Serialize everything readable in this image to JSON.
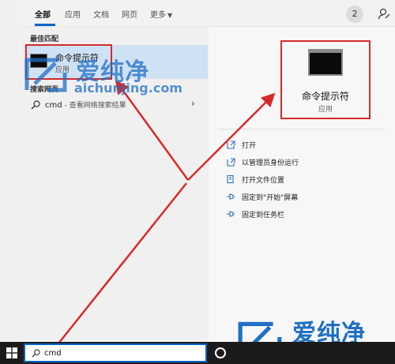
{
  "tabs": [
    {
      "label": "全部"
    },
    {
      "label": "应用"
    },
    {
      "label": "文档"
    },
    {
      "label": "网页"
    },
    {
      "label": "更多"
    }
  ],
  "header": {
    "badge_count": "2"
  },
  "best_match": {
    "section_label": "最佳匹配",
    "title": "命令提示符",
    "subtitle": "应用"
  },
  "web": {
    "section_label": "搜索网页",
    "query": "cmd",
    "suffix": " - 查看网络搜索结果"
  },
  "preview": {
    "title": "命令提示符",
    "subtitle": "应用",
    "actions": [
      {
        "label": "打开",
        "icon": "open-icon"
      },
      {
        "label": "以管理员身份运行",
        "icon": "shield-admin-icon"
      },
      {
        "label": "打开文件位置",
        "icon": "file-location-icon"
      },
      {
        "label": "固定到\"开始\"屏幕",
        "icon": "pin-icon"
      },
      {
        "label": "固定到任务栏",
        "icon": "pin-icon"
      }
    ]
  },
  "taskbar": {
    "search_value": "cmd"
  },
  "watermark": {
    "brand_cn": "爱纯净",
    "brand_en": "aichunjing.com"
  },
  "colors": {
    "accent": "#0a64c8",
    "highlight": "#cfe1f4",
    "annotation_red": "#d62b2b",
    "watermark_blue": "#1f6fc4"
  }
}
